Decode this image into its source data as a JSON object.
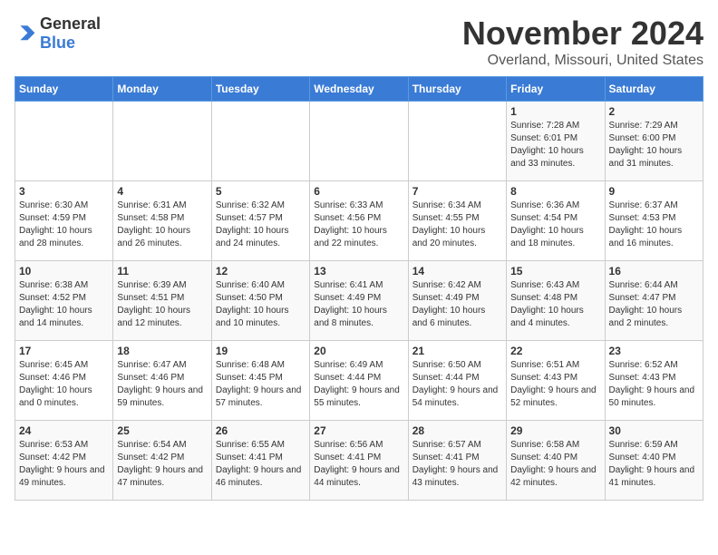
{
  "header": {
    "logo_general": "General",
    "logo_blue": "Blue",
    "month": "November 2024",
    "location": "Overland, Missouri, United States"
  },
  "days_of_week": [
    "Sunday",
    "Monday",
    "Tuesday",
    "Wednesday",
    "Thursday",
    "Friday",
    "Saturday"
  ],
  "weeks": [
    [
      {
        "day": "",
        "info": ""
      },
      {
        "day": "",
        "info": ""
      },
      {
        "day": "",
        "info": ""
      },
      {
        "day": "",
        "info": ""
      },
      {
        "day": "",
        "info": ""
      },
      {
        "day": "1",
        "info": "Sunrise: 7:28 AM\nSunset: 6:01 PM\nDaylight: 10 hours and 33 minutes."
      },
      {
        "day": "2",
        "info": "Sunrise: 7:29 AM\nSunset: 6:00 PM\nDaylight: 10 hours and 31 minutes."
      }
    ],
    [
      {
        "day": "3",
        "info": "Sunrise: 6:30 AM\nSunset: 4:59 PM\nDaylight: 10 hours and 28 minutes."
      },
      {
        "day": "4",
        "info": "Sunrise: 6:31 AM\nSunset: 4:58 PM\nDaylight: 10 hours and 26 minutes."
      },
      {
        "day": "5",
        "info": "Sunrise: 6:32 AM\nSunset: 4:57 PM\nDaylight: 10 hours and 24 minutes."
      },
      {
        "day": "6",
        "info": "Sunrise: 6:33 AM\nSunset: 4:56 PM\nDaylight: 10 hours and 22 minutes."
      },
      {
        "day": "7",
        "info": "Sunrise: 6:34 AM\nSunset: 4:55 PM\nDaylight: 10 hours and 20 minutes."
      },
      {
        "day": "8",
        "info": "Sunrise: 6:36 AM\nSunset: 4:54 PM\nDaylight: 10 hours and 18 minutes."
      },
      {
        "day": "9",
        "info": "Sunrise: 6:37 AM\nSunset: 4:53 PM\nDaylight: 10 hours and 16 minutes."
      }
    ],
    [
      {
        "day": "10",
        "info": "Sunrise: 6:38 AM\nSunset: 4:52 PM\nDaylight: 10 hours and 14 minutes."
      },
      {
        "day": "11",
        "info": "Sunrise: 6:39 AM\nSunset: 4:51 PM\nDaylight: 10 hours and 12 minutes."
      },
      {
        "day": "12",
        "info": "Sunrise: 6:40 AM\nSunset: 4:50 PM\nDaylight: 10 hours and 10 minutes."
      },
      {
        "day": "13",
        "info": "Sunrise: 6:41 AM\nSunset: 4:49 PM\nDaylight: 10 hours and 8 minutes."
      },
      {
        "day": "14",
        "info": "Sunrise: 6:42 AM\nSunset: 4:49 PM\nDaylight: 10 hours and 6 minutes."
      },
      {
        "day": "15",
        "info": "Sunrise: 6:43 AM\nSunset: 4:48 PM\nDaylight: 10 hours and 4 minutes."
      },
      {
        "day": "16",
        "info": "Sunrise: 6:44 AM\nSunset: 4:47 PM\nDaylight: 10 hours and 2 minutes."
      }
    ],
    [
      {
        "day": "17",
        "info": "Sunrise: 6:45 AM\nSunset: 4:46 PM\nDaylight: 10 hours and 0 minutes."
      },
      {
        "day": "18",
        "info": "Sunrise: 6:47 AM\nSunset: 4:46 PM\nDaylight: 9 hours and 59 minutes."
      },
      {
        "day": "19",
        "info": "Sunrise: 6:48 AM\nSunset: 4:45 PM\nDaylight: 9 hours and 57 minutes."
      },
      {
        "day": "20",
        "info": "Sunrise: 6:49 AM\nSunset: 4:44 PM\nDaylight: 9 hours and 55 minutes."
      },
      {
        "day": "21",
        "info": "Sunrise: 6:50 AM\nSunset: 4:44 PM\nDaylight: 9 hours and 54 minutes."
      },
      {
        "day": "22",
        "info": "Sunrise: 6:51 AM\nSunset: 4:43 PM\nDaylight: 9 hours and 52 minutes."
      },
      {
        "day": "23",
        "info": "Sunrise: 6:52 AM\nSunset: 4:43 PM\nDaylight: 9 hours and 50 minutes."
      }
    ],
    [
      {
        "day": "24",
        "info": "Sunrise: 6:53 AM\nSunset: 4:42 PM\nDaylight: 9 hours and 49 minutes."
      },
      {
        "day": "25",
        "info": "Sunrise: 6:54 AM\nSunset: 4:42 PM\nDaylight: 9 hours and 47 minutes."
      },
      {
        "day": "26",
        "info": "Sunrise: 6:55 AM\nSunset: 4:41 PM\nDaylight: 9 hours and 46 minutes."
      },
      {
        "day": "27",
        "info": "Sunrise: 6:56 AM\nSunset: 4:41 PM\nDaylight: 9 hours and 44 minutes."
      },
      {
        "day": "28",
        "info": "Sunrise: 6:57 AM\nSunset: 4:41 PM\nDaylight: 9 hours and 43 minutes."
      },
      {
        "day": "29",
        "info": "Sunrise: 6:58 AM\nSunset: 4:40 PM\nDaylight: 9 hours and 42 minutes."
      },
      {
        "day": "30",
        "info": "Sunrise: 6:59 AM\nSunset: 4:40 PM\nDaylight: 9 hours and 41 minutes."
      }
    ]
  ]
}
